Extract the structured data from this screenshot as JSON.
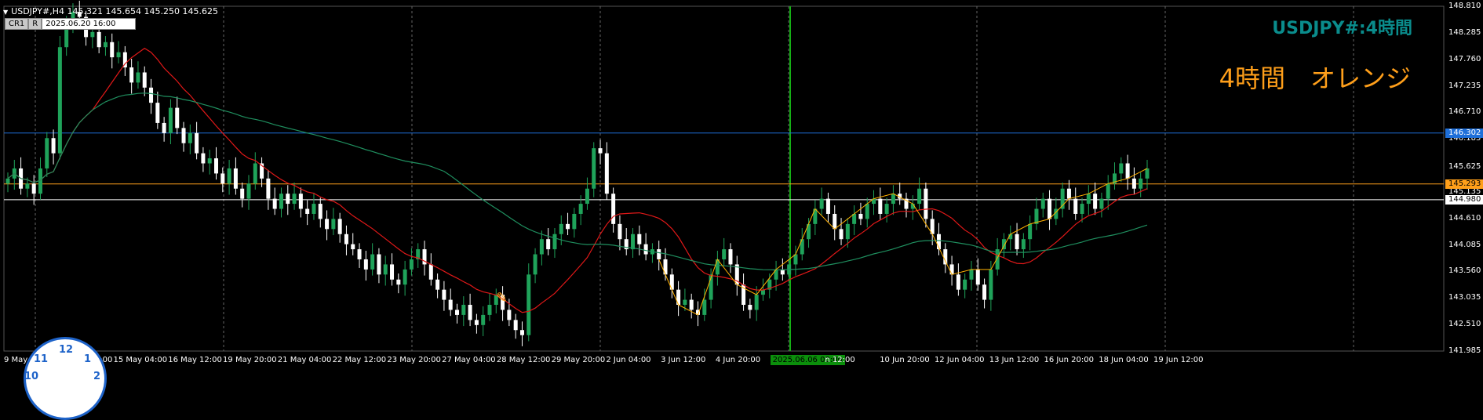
{
  "header": {
    "symbol_line": "USDJPY#,H4  145.321 145.654 145.250 145.625",
    "cr_label": "CR1",
    "r_label": "R",
    "date_value": "2025.06.20 16:00"
  },
  "titles": {
    "symbol_timeframe": "USDJPY#:4時間",
    "orange_label": "4時間　オレンジ"
  },
  "clock": {
    "twelve": "12",
    "one": "1",
    "two": "2",
    "eleven": "11",
    "ten": "10"
  },
  "colors": {
    "background": "#000000",
    "bull": "#1fa35a",
    "bear": "#ffffff",
    "ma_fast": "#e01818",
    "ma_slow": "#1f8f5f",
    "zigzag": "#ffb000",
    "line_blue": "#1e6fd9",
    "line_orange": "#ff9f1a",
    "line_white": "#ffffff",
    "vline": "#15b015"
  },
  "chart_data": {
    "type": "candlestick",
    "symbol": "USDJPY#",
    "timeframe": "H4",
    "ylim": [
      141.985,
      148.81
    ],
    "y_ticks": [
      "148.810",
      "148.285",
      "147.760",
      "147.235",
      "146.710",
      "146.185",
      "145.625",
      "145.135",
      "144.980",
      "144.610",
      "144.085",
      "143.560",
      "143.035",
      "142.510",
      "141.985"
    ],
    "x_ticks": [
      "9 May",
      "13 May 20:00",
      "15 May 04:00",
      "16 May 12:00",
      "19 May 20:00",
      "21 May 04:00",
      "22 May 12:00",
      "23 May 20:00",
      "27 May 04:00",
      "28 May 12:00",
      "29 May 20:00",
      "2 Jun 04:00",
      "3 Jun 12:00",
      "4 Jun 20:00",
      "2025.06.06 00:00",
      "n 12:00",
      "10 Jun 20:00",
      "12 Jun 04:00",
      "13 Jun 12:00",
      "16 Jun 20:00",
      "18 Jun 04:00",
      "19 Jun 12:00"
    ],
    "highlight_x_label": "2025.06.06 00:00",
    "horizontal_lines": [
      {
        "price": "146.302",
        "color": "blue"
      },
      {
        "price": "145.293",
        "color": "orange"
      },
      {
        "price": "144.980",
        "color": "white"
      }
    ],
    "closes": [
      145.4,
      145.6,
      145.2,
      145.3,
      145.1,
      145.6,
      146.2,
      145.9,
      148.0,
      148.5,
      148.7,
      148.6,
      148.2,
      148.3,
      148.0,
      148.1,
      147.8,
      147.9,
      147.6,
      147.3,
      147.5,
      147.2,
      146.9,
      146.5,
      146.3,
      146.8,
      146.4,
      146.1,
      146.3,
      145.9,
      145.7,
      145.8,
      145.5,
      145.3,
      145.6,
      145.2,
      145.0,
      145.3,
      145.7,
      145.4,
      145.0,
      144.8,
      145.1,
      144.9,
      145.1,
      144.8,
      144.7,
      144.9,
      144.6,
      144.4,
      144.6,
      144.3,
      144.1,
      144.0,
      143.8,
      143.6,
      143.9,
      143.5,
      143.7,
      143.4,
      143.3,
      143.6,
      143.8,
      144.0,
      143.7,
      143.4,
      143.2,
      143.0,
      142.8,
      142.7,
      142.9,
      142.6,
      142.5,
      142.7,
      142.9,
      143.1,
      142.8,
      142.6,
      142.4,
      142.3,
      143.5,
      143.9,
      144.2,
      144.0,
      144.3,
      144.5,
      144.4,
      144.7,
      144.9,
      145.2,
      146.0,
      145.9,
      145.1,
      144.5,
      144.2,
      144.0,
      144.3,
      144.1,
      143.9,
      144.0,
      143.8,
      143.5,
      143.2,
      142.9,
      143.0,
      142.8,
      142.7,
      143.0,
      143.5,
      143.8,
      144.0,
      143.7,
      143.3,
      142.9,
      142.8,
      143.1,
      143.2,
      143.4,
      143.6,
      143.5,
      143.7,
      143.9,
      144.2,
      144.5,
      144.8,
      145.0,
      144.7,
      144.4,
      144.2,
      144.5,
      144.7,
      144.6,
      144.9,
      145.0,
      144.7,
      144.9,
      145.1,
      145.0,
      144.8,
      144.9,
      145.2,
      144.6,
      144.3,
      144.0,
      143.7,
      143.5,
      143.2,
      143.4,
      143.6,
      143.3,
      143.0,
      143.6,
      144.0,
      144.2,
      144.3,
      144.0,
      144.2,
      144.5,
      144.8,
      145.0,
      144.6,
      144.8,
      145.2,
      145.0,
      144.7,
      144.9,
      145.1,
      144.8,
      145.0,
      145.3,
      145.5,
      145.7,
      145.4,
      145.2,
      145.4,
      145.6
    ]
  }
}
